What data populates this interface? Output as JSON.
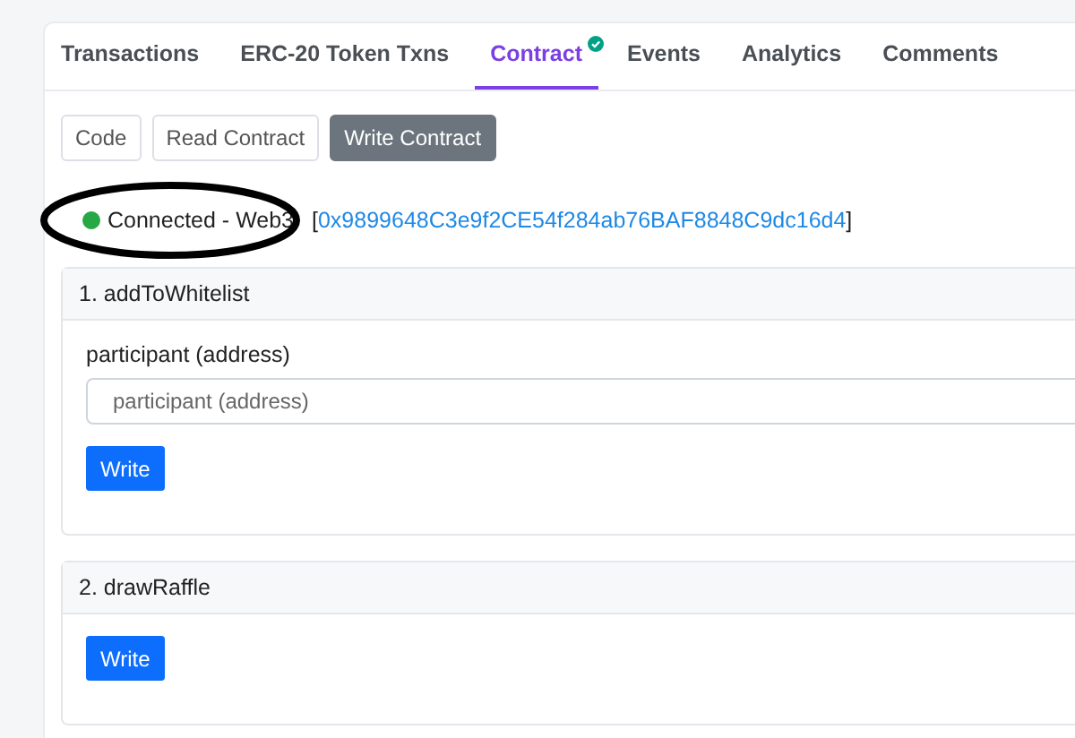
{
  "tabs": [
    {
      "label": "Transactions",
      "selected": false,
      "verified": false
    },
    {
      "label": "ERC-20 Token Txns",
      "selected": false,
      "verified": false
    },
    {
      "label": "Contract",
      "selected": true,
      "verified": true
    },
    {
      "label": "Events",
      "selected": false,
      "verified": false
    },
    {
      "label": "Analytics",
      "selected": false,
      "verified": false
    },
    {
      "label": "Comments",
      "selected": false,
      "verified": false
    }
  ],
  "subtabs": [
    {
      "label": "Code",
      "selected": false
    },
    {
      "label": "Read Contract",
      "selected": false
    },
    {
      "label": "Write Contract",
      "selected": true
    }
  ],
  "connection": {
    "connected": true,
    "status": "Connected - Web3",
    "open_bracket": "[",
    "address": "0x9899648C3e9f2CE54f284ab76BAF8848C9dc16d4",
    "close_bracket": "]"
  },
  "functions": [
    {
      "title": "1. addToWhitelist",
      "inputs": [
        {
          "label": "participant (address)",
          "placeholder": "participant (address)"
        }
      ],
      "button": "Write"
    },
    {
      "title": "2. drawRaffle",
      "button": "Write"
    }
  ]
}
